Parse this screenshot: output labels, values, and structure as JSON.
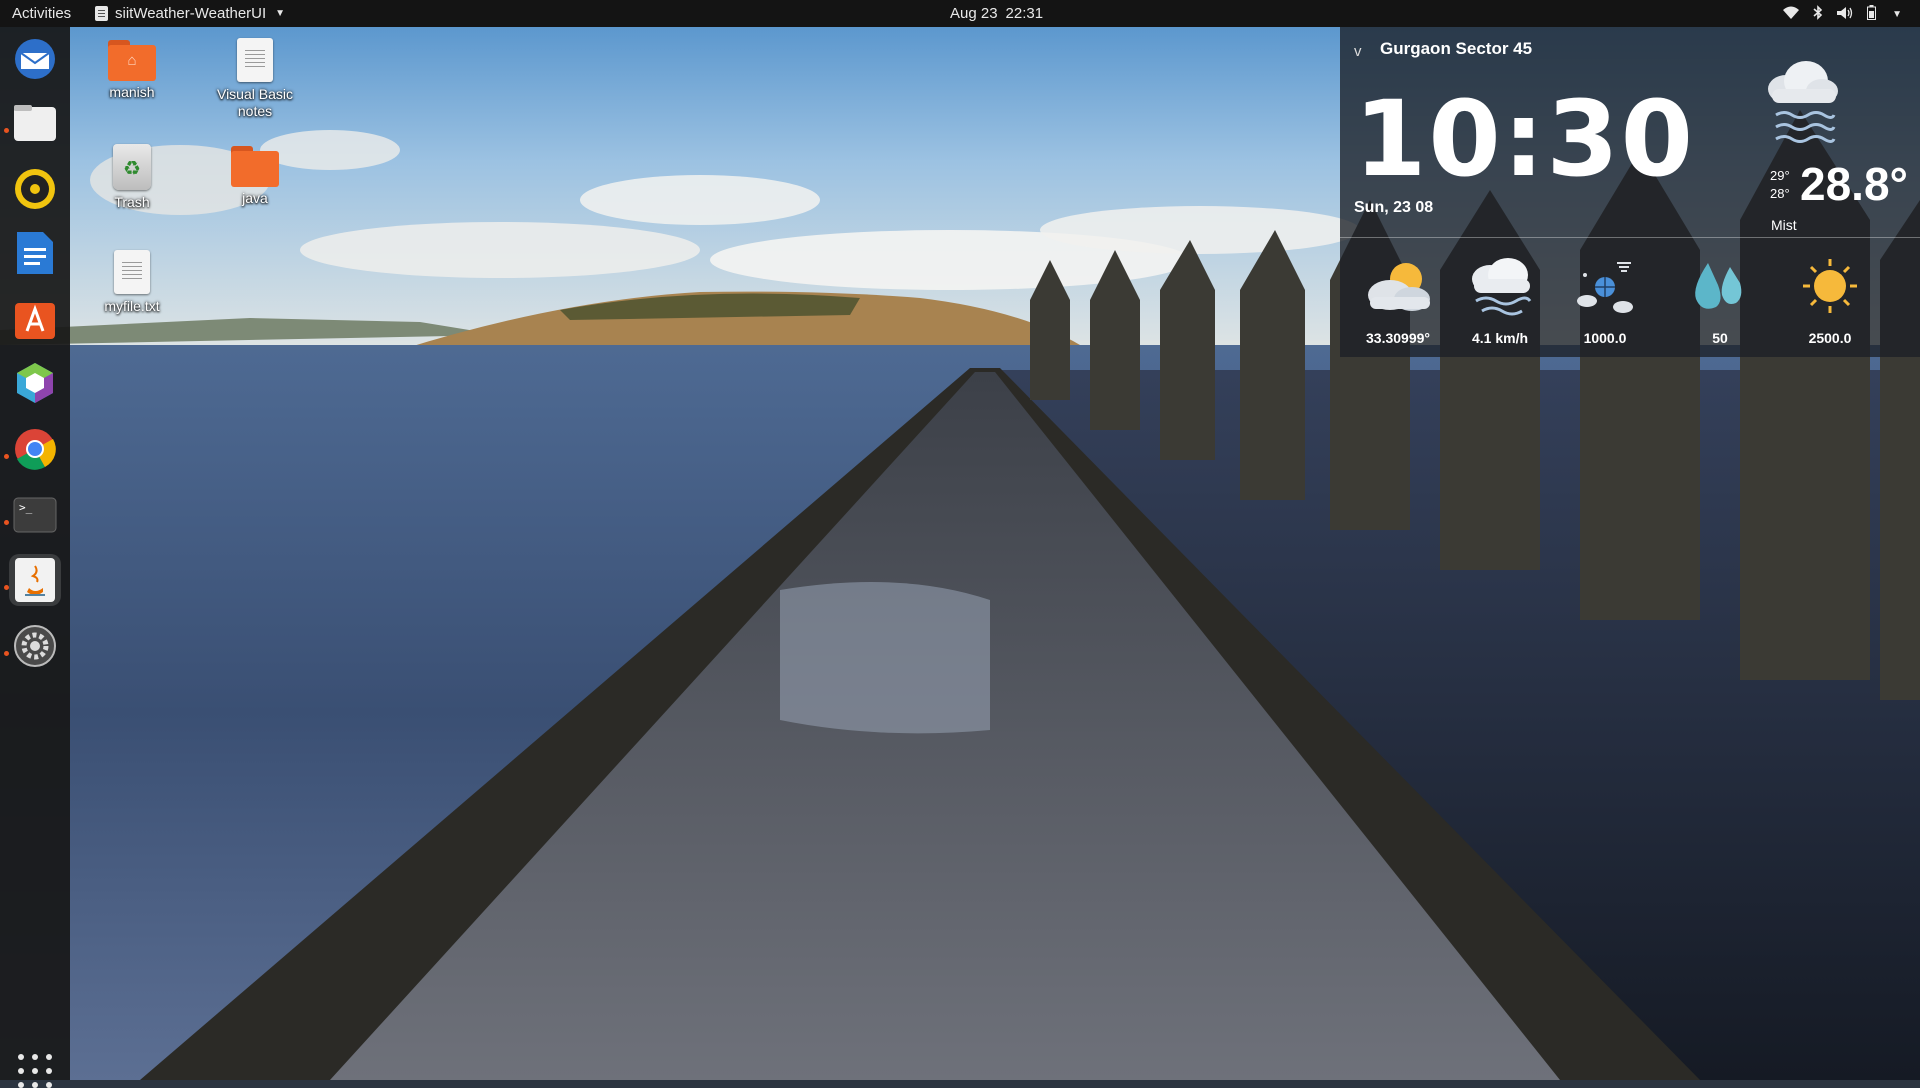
{
  "topbar": {
    "activities": "Activities",
    "app_name": "siitWeather-WeatherUI",
    "date": "Aug 23",
    "time": "22:31"
  },
  "dock": {
    "items": [
      "thunderbird-icon",
      "files-icon",
      "rhythmbox-icon",
      "writer-icon",
      "software-icon",
      "code-icon",
      "chrome-icon",
      "terminal-icon",
      "java-icon",
      "settings-icon"
    ]
  },
  "desktop": {
    "icons": [
      {
        "label": "manish"
      },
      {
        "label": "Visual Basic notes"
      },
      {
        "label": "Trash"
      },
      {
        "label": "java"
      },
      {
        "label": "myfile.txt"
      }
    ]
  },
  "weather": {
    "collapse": "v",
    "location": "Gurgaon Sector 45",
    "time": "10:30",
    "date": "Sun, 23 08",
    "high": "29°",
    "low": "28°",
    "temperature": "28.8°",
    "description": "Mist",
    "stats": [
      {
        "icon": "partly-sunny-icon",
        "value": "33.30999°"
      },
      {
        "icon": "wind-icon",
        "value": "4.1 km/h"
      },
      {
        "icon": "pressure-icon",
        "value": "1000.0"
      },
      {
        "icon": "humidity-icon",
        "value": "50"
      },
      {
        "icon": "sun-icon",
        "value": "2500.0"
      }
    ]
  },
  "colors": {
    "accent": "#e95420",
    "topbar": "#141414",
    "dock": "#181818",
    "folder": "#f26c2b"
  }
}
